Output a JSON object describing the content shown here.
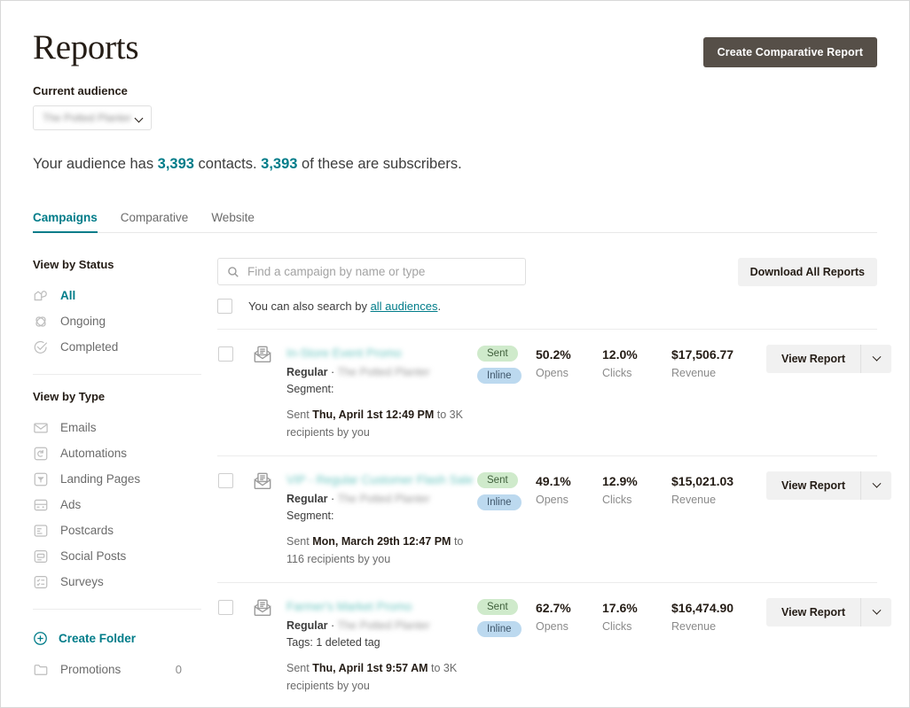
{
  "header": {
    "title": "Reports",
    "create_comparative_button": "Create Comparative Report",
    "audience_label": "Current audience",
    "audience_value": "The Potted Planter",
    "sentence_part1": "Your audience has ",
    "contacts_count": "3,393",
    "sentence_part2": " contacts. ",
    "subscribers_count": "3,393",
    "sentence_part3": " of these are subscribers."
  },
  "tabs": [
    {
      "label": "Campaigns",
      "active": true
    },
    {
      "label": "Comparative",
      "active": false
    },
    {
      "label": "Website",
      "active": false
    }
  ],
  "sidebar": {
    "status_heading": "View by Status",
    "status_items": [
      {
        "label": "All",
        "icon": "all-campaigns-icon",
        "active": true
      },
      {
        "label": "Ongoing",
        "icon": "ongoing-icon",
        "active": false
      },
      {
        "label": "Completed",
        "icon": "completed-check-icon",
        "active": false
      }
    ],
    "type_heading": "View by Type",
    "type_items": [
      {
        "label": "Emails",
        "icon": "envelope-icon"
      },
      {
        "label": "Automations",
        "icon": "automation-icon"
      },
      {
        "label": "Landing Pages",
        "icon": "landing-page-icon"
      },
      {
        "label": "Ads",
        "icon": "ads-icon"
      },
      {
        "label": "Postcards",
        "icon": "postcard-icon"
      },
      {
        "label": "Social Posts",
        "icon": "social-post-icon"
      },
      {
        "label": "Surveys",
        "icon": "survey-icon"
      }
    ],
    "create_folder_label": "Create Folder",
    "folders": [
      {
        "label": "Promotions",
        "count": "0"
      }
    ]
  },
  "toolbar": {
    "search_placeholder": "Find a campaign by name or type",
    "search_value": "",
    "download_button": "Download All Reports",
    "search_note_prefix": "You can also search by ",
    "search_note_link": "all audiences",
    "search_note_suffix": "."
  },
  "campaigns": [
    {
      "title": "In-Store Event Promo",
      "type": "Regular",
      "audience": "The Potted Planter",
      "detail_label": "Segment:",
      "sent_prefix": "Sent ",
      "sent_date": "Thu, April 1st 12:49 PM",
      "sent_suffix": " to 3K recipients by you",
      "badges": [
        "Sent",
        "Inline"
      ],
      "opens_value": "50.2%",
      "opens_label": "Opens",
      "clicks_value": "12.0%",
      "clicks_label": "Clicks",
      "revenue_value": "$17,506.77",
      "revenue_label": "Revenue",
      "action_label": "View Report"
    },
    {
      "title": "VIP - Regular Customer Flash Sale",
      "type": "Regular",
      "audience": "The Potted Planter",
      "detail_label": "Segment:",
      "sent_prefix": "Sent ",
      "sent_date": "Mon, March 29th 12:47 PM",
      "sent_suffix": " to 116 recipients by you",
      "badges": [
        "Sent",
        "Inline"
      ],
      "opens_value": "49.1%",
      "opens_label": "Opens",
      "clicks_value": "12.9%",
      "clicks_label": "Clicks",
      "revenue_value": "$15,021.03",
      "revenue_label": "Revenue",
      "action_label": "View Report"
    },
    {
      "title": "Farmer's Market Promo",
      "type": "Regular",
      "audience": "The Potted Planter",
      "detail_label": "Tags: 1 deleted tag",
      "sent_prefix": "Sent ",
      "sent_date": "Thu, April 1st 9:57 AM",
      "sent_suffix": " to 3K recipients by you",
      "badges": [
        "Sent",
        "Inline"
      ],
      "opens_value": "62.7%",
      "opens_label": "Opens",
      "clicks_value": "17.6%",
      "clicks_label": "Clicks",
      "revenue_value": "$16,474.90",
      "revenue_label": "Revenue",
      "action_label": "View Report"
    }
  ],
  "colors": {
    "accent_teal": "#007c89",
    "dark_button": "#564f48",
    "badge_sent_bg": "#cfeacb",
    "badge_inline_bg": "#bcd9ef",
    "light_button": "#f1f1f1"
  }
}
